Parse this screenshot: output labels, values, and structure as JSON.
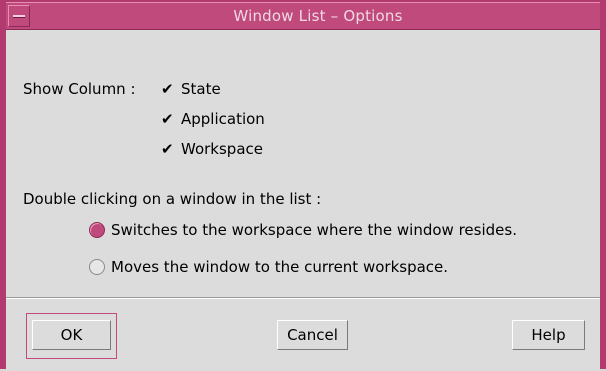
{
  "window": {
    "title": "Window List – Options"
  },
  "show_column": {
    "label": "Show Column :",
    "options": [
      {
        "label": "State",
        "checked": true
      },
      {
        "label": "Application",
        "checked": true
      },
      {
        "label": "Workspace",
        "checked": true
      }
    ]
  },
  "double_click": {
    "label": "Double clicking on a window in the list :",
    "options": [
      {
        "label": "Switches to the workspace where the window resides.",
        "selected": true
      },
      {
        "label": "Moves the window to the current workspace.",
        "selected": false
      }
    ]
  },
  "buttons": {
    "ok": "OK",
    "cancel": "Cancel",
    "help": "Help"
  },
  "colors": {
    "accent": "#c04a7c",
    "frame": "#b23a6e",
    "background": "#dcdcdc"
  },
  "icons": {
    "window_menu": "window-menu-icon",
    "check": "checkmark-icon"
  }
}
